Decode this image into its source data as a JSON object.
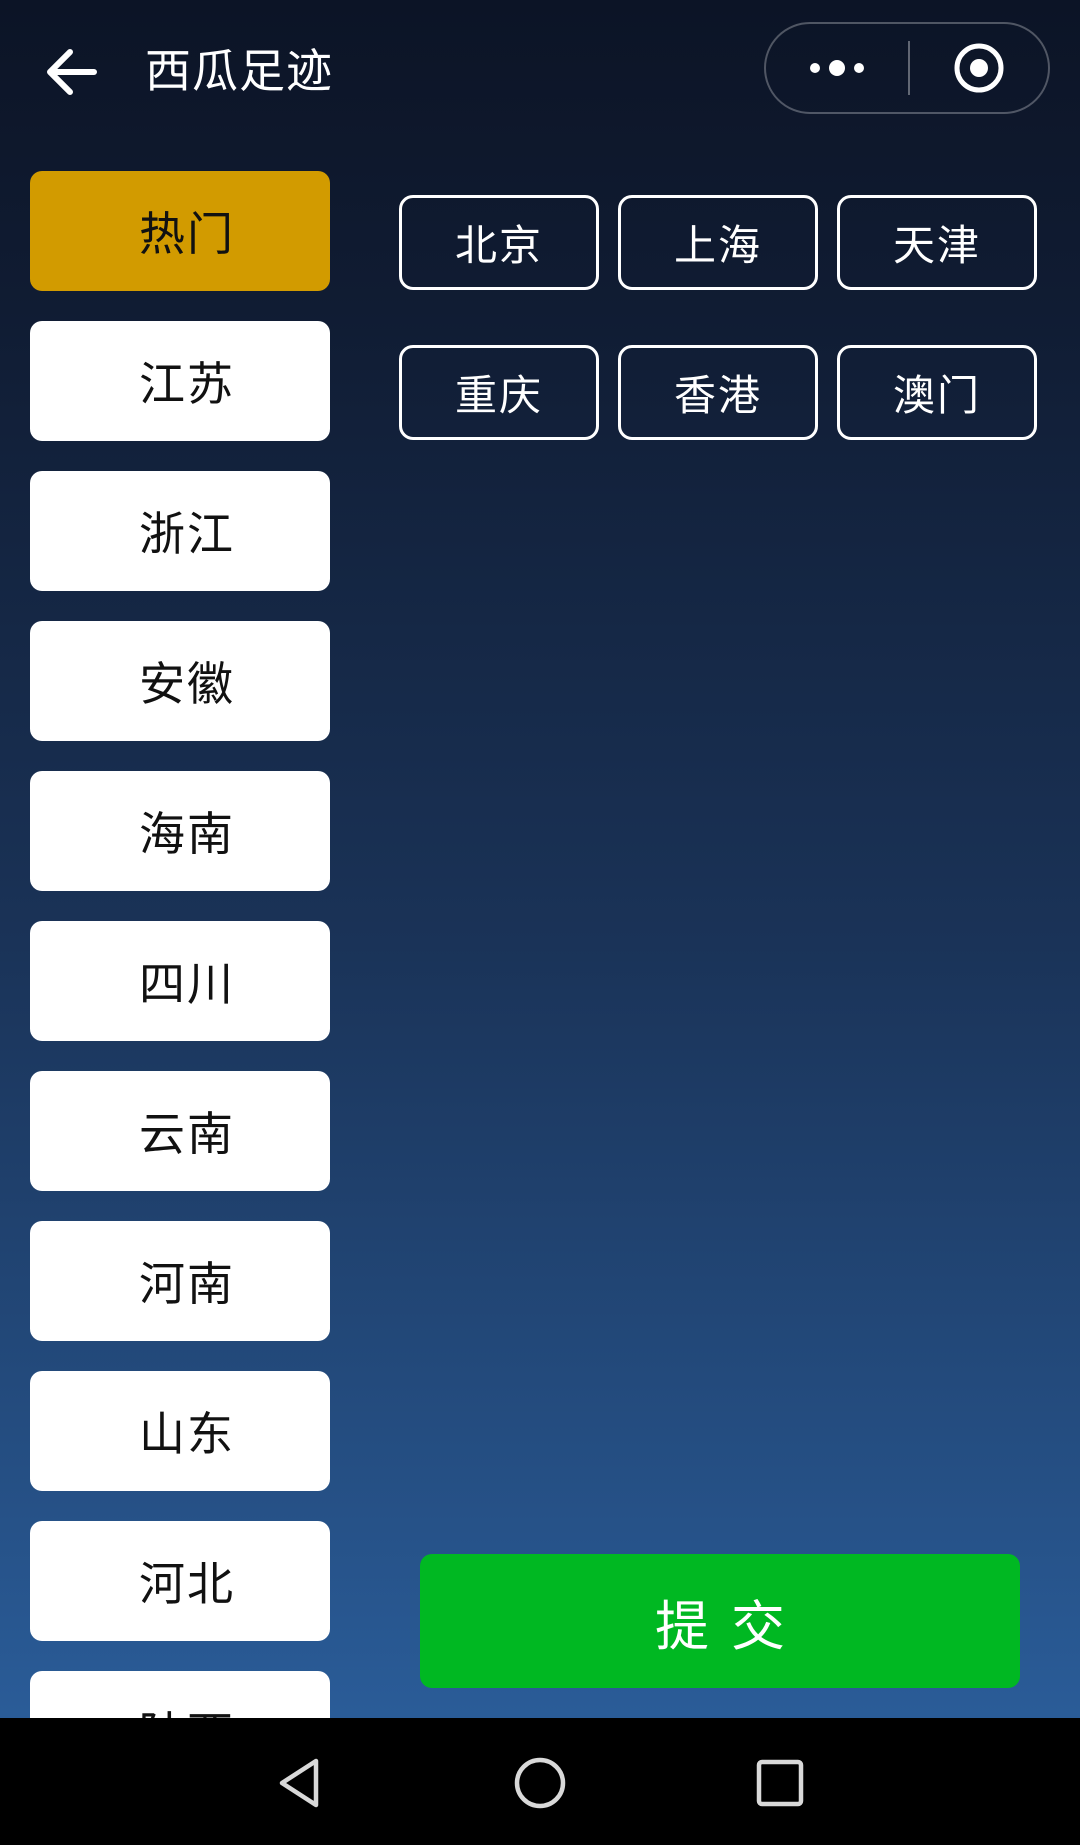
{
  "header": {
    "title": "西瓜足迹",
    "back_icon": "arrow-left-icon",
    "more_icon": "more-dots-icon",
    "close_icon": "target-circle-icon"
  },
  "sidebar": {
    "items": [
      {
        "label": "热门",
        "active": true
      },
      {
        "label": "江苏",
        "active": false
      },
      {
        "label": "浙江",
        "active": false
      },
      {
        "label": "安徽",
        "active": false
      },
      {
        "label": "海南",
        "active": false
      },
      {
        "label": "四川",
        "active": false
      },
      {
        "label": "云南",
        "active": false
      },
      {
        "label": "河南",
        "active": false
      },
      {
        "label": "山东",
        "active": false
      },
      {
        "label": "河北",
        "active": false
      },
      {
        "label": "陕西",
        "active": false
      }
    ]
  },
  "cities": [
    {
      "label": "北京"
    },
    {
      "label": "上海"
    },
    {
      "label": "天津"
    },
    {
      "label": "重庆"
    },
    {
      "label": "香港"
    },
    {
      "label": "澳门"
    }
  ],
  "submit_label": "提交",
  "navbar": {
    "back_icon": "triangle-back-icon",
    "home_icon": "circle-home-icon",
    "recents_icon": "square-recents-icon"
  },
  "colors": {
    "active_tab": "#d29b00",
    "submit": "#00b822",
    "background_top": "#0c1426",
    "background_bottom": "#2a5c98"
  }
}
